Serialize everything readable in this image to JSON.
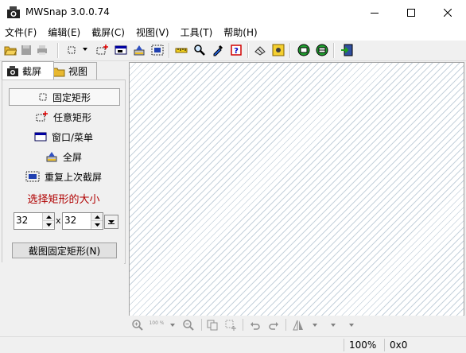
{
  "window": {
    "title": "MWSnap 3.0.0.74"
  },
  "menu": [
    "文件(F)",
    "编辑(E)",
    "截屏(C)",
    "视图(V)",
    "工具(T)",
    "帮助(H)"
  ],
  "tabs": {
    "capture": "截屏",
    "view": "视图"
  },
  "capture_modes": {
    "fixed": "固定矩形",
    "any": "任意矩形",
    "window": "窗口/菜单",
    "full": "全屏",
    "repeat": "重复上次截屏"
  },
  "size": {
    "label": "选择矩形的大小",
    "width": "32",
    "height": "32",
    "x": "x"
  },
  "capture_button": "截图固定矩形(N)",
  "zoom_percent_icon": "100 %",
  "status": {
    "zoom": "100%",
    "coords": "0x0"
  },
  "colors": {
    "size_label": "#b00000",
    "hatch": "#c6d2dc"
  }
}
